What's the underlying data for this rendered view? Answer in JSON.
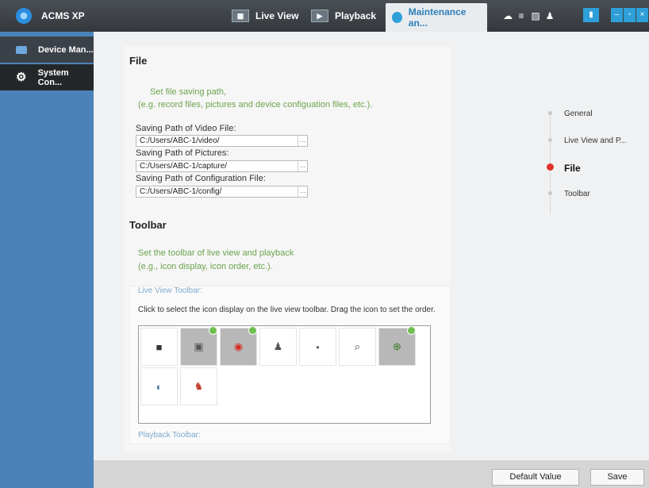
{
  "app": {
    "title": "ACMS XP"
  },
  "nav": {
    "tabs": [
      {
        "label": "Live View"
      },
      {
        "label": "Playback"
      },
      {
        "label": "Maintenance an..."
      }
    ]
  },
  "sidebar": {
    "items": [
      {
        "label": "Device Man..."
      },
      {
        "label": "System Con..."
      }
    ]
  },
  "file_section": {
    "title": "File",
    "desc_line1": "Set file saving path,",
    "desc_line2": "(e.g. record files, pictures and device configuation files, etc.).",
    "fields": [
      {
        "label": "Saving Path of Video File:",
        "value": "C:/Users/ABC-1/video/",
        "browse": "…"
      },
      {
        "label": "Saving Path of Pictures:",
        "value": "C:/Users/ABC-1/capture/",
        "browse": "…"
      },
      {
        "label": "Saving Path of Configuration File:",
        "value": "C:/Users/ABC-1/config/",
        "browse": "…"
      }
    ]
  },
  "toolbar_section": {
    "title": "Toolbar",
    "desc_line1": "Set the toolbar of live view and playback",
    "desc_line2": "(e.g., icon display, icon order, etc.).",
    "live_view_label": "Live View Toolbar:",
    "instruction": "Click to select the icon display on the live view toolbar. Drag the icon to set the order.",
    "playback_label": "Playback Toolbar:"
  },
  "toolbar_icons": [
    {
      "icon": "stop-icon",
      "selected": false,
      "checked": false,
      "glyph": "■",
      "color": "#333333"
    },
    {
      "icon": "capture-icon",
      "selected": true,
      "checked": true,
      "glyph": "▣",
      "color": "#555555"
    },
    {
      "icon": "record-icon",
      "selected": true,
      "checked": true,
      "glyph": "◉",
      "color": "#d62a24"
    },
    {
      "icon": "person-icon",
      "selected": false,
      "checked": false,
      "glyph": "♟",
      "color": "#555555"
    },
    {
      "icon": "microphone-icon",
      "selected": false,
      "checked": false,
      "glyph": "•",
      "color": "#666666"
    },
    {
      "icon": "zoom-icon",
      "selected": false,
      "checked": false,
      "glyph": "⌕",
      "color": "#444444"
    },
    {
      "icon": "ptz-icon",
      "selected": true,
      "checked": true,
      "glyph": "⊕",
      "color": "#3a7a2a"
    },
    {
      "icon": "camera-status-icon",
      "selected": false,
      "checked": false,
      "glyph": "◐",
      "color": "#4a78a8"
    },
    {
      "icon": "broadcast-icon",
      "selected": false,
      "checked": false,
      "glyph": "♞",
      "color": "#c0392b"
    }
  ],
  "steps": [
    {
      "label": "General"
    },
    {
      "label": "Live View and P..."
    },
    {
      "label": "File"
    },
    {
      "label": "Toolbar"
    }
  ],
  "footer": {
    "default_label": "Default Value",
    "save_label": "Save"
  },
  "colors": {
    "accent": "#2e9fd8",
    "sidebar": "#4b83b9",
    "hint_green": "#6da34d",
    "active_step": "#e0312a",
    "check": "#6dc04f"
  }
}
